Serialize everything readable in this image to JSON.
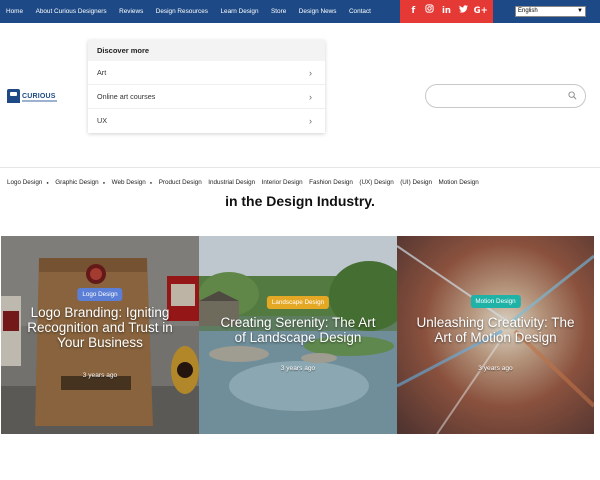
{
  "topnav": {
    "items": [
      "Home",
      "About Curious Designers",
      "Reviews",
      "Design Resources",
      "Learn Design",
      "Store",
      "Design News",
      "Contact"
    ]
  },
  "social": {
    "icons": [
      {
        "name": "facebook-icon",
        "glyph": "f"
      },
      {
        "name": "instagram-icon",
        "glyph": "◎"
      },
      {
        "name": "linkedin-icon",
        "glyph": "in"
      },
      {
        "name": "twitter-icon",
        "glyph": "🐦"
      },
      {
        "name": "googleplus-icon",
        "glyph": "G+"
      }
    ],
    "bg_color": "#e53935"
  },
  "language": {
    "selected": "English"
  },
  "logo": {
    "text": "CURIOUS"
  },
  "dropdown": {
    "heading": "Discover more",
    "items": [
      "Art",
      "Online art courses",
      "UX"
    ]
  },
  "search": {
    "placeholder": "",
    "value": ""
  },
  "catnav": {
    "items": [
      {
        "label": "Logo Design",
        "submenu": true
      },
      {
        "label": "Graphic Design",
        "submenu": true
      },
      {
        "label": "Web Design",
        "submenu": true
      },
      {
        "label": "Product Design",
        "submenu": false
      },
      {
        "label": "Industrial Design",
        "submenu": false
      },
      {
        "label": "Interior Design",
        "submenu": false
      },
      {
        "label": "Fashion Design",
        "submenu": false
      },
      {
        "label": "(UX) Design",
        "submenu": false
      },
      {
        "label": "(UI) Design",
        "submenu": false
      },
      {
        "label": "Motion Design",
        "submenu": false
      }
    ]
  },
  "headline": "in the Design Industry.",
  "cards": [
    {
      "badge": "Logo Design",
      "badge_color": "#5b7fd6",
      "title": "Logo Branding: Igniting Recognition and Trust in Your Business",
      "date": "3 years ago"
    },
    {
      "badge": "Landscape Design",
      "badge_color": "#e5a824",
      "title": "Creating Serenity: The Art of Landscape Design",
      "date": "3 years ago"
    },
    {
      "badge": "Motion Design",
      "badge_color": "#1fb2a6",
      "title": "Unleashing Creativity: The Art of Motion Design",
      "date": "3 years ago"
    }
  ],
  "colors": {
    "navbar": "#1d4a86",
    "accent": "#e53935"
  }
}
